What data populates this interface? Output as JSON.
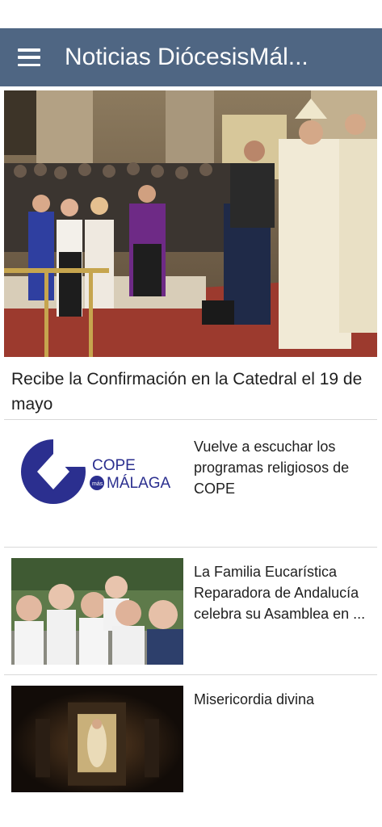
{
  "app_bar": {
    "title": "Noticias DiócesisMál...",
    "menu_icon": "hamburger-menu-icon",
    "color": "#4f6683"
  },
  "featured": {
    "title": "Recibe la Confirmación en la Catedral el 19 de mayo",
    "image": "confirmation-ceremony-cathedral"
  },
  "news": [
    {
      "title": "Vuelve a escuchar los programas religiosos de COPE",
      "image": "cope-malaga-logo",
      "logo_cope": "COPE",
      "logo_mas": "más",
      "logo_malaga": "MÁLAGA"
    },
    {
      "title": "La Familia Eucarística Reparadora de Andalucía celebra su Asamblea en ...",
      "image": "group-of-smiling-women"
    },
    {
      "title": "Misericordia divina",
      "image": "divine-mercy-altarpiece"
    }
  ],
  "colors": {
    "cope_blue": "#2b2f8f"
  }
}
